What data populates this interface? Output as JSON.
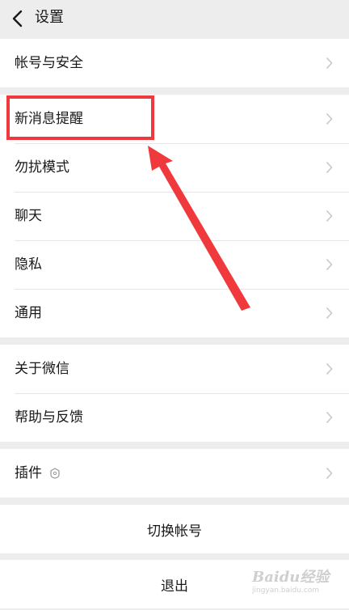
{
  "header": {
    "title": "设置"
  },
  "groups": {
    "account": {
      "items": [
        "帐号与安全"
      ]
    },
    "main": {
      "items": [
        "新消息提醒",
        "勿扰模式",
        "聊天",
        "隐私",
        "通用"
      ]
    },
    "about": {
      "items": [
        "关于微信",
        "帮助与反馈"
      ]
    },
    "plugins": {
      "items": [
        "插件"
      ]
    }
  },
  "actions": {
    "switch_account": "切换帐号",
    "logout": "退出"
  },
  "watermark": {
    "brand": "Baidu经验",
    "url": "jingyan.baidu.com"
  },
  "colors": {
    "background": "#ededed",
    "annotation": "#f0393d",
    "chevron": "#c7c7cc"
  }
}
